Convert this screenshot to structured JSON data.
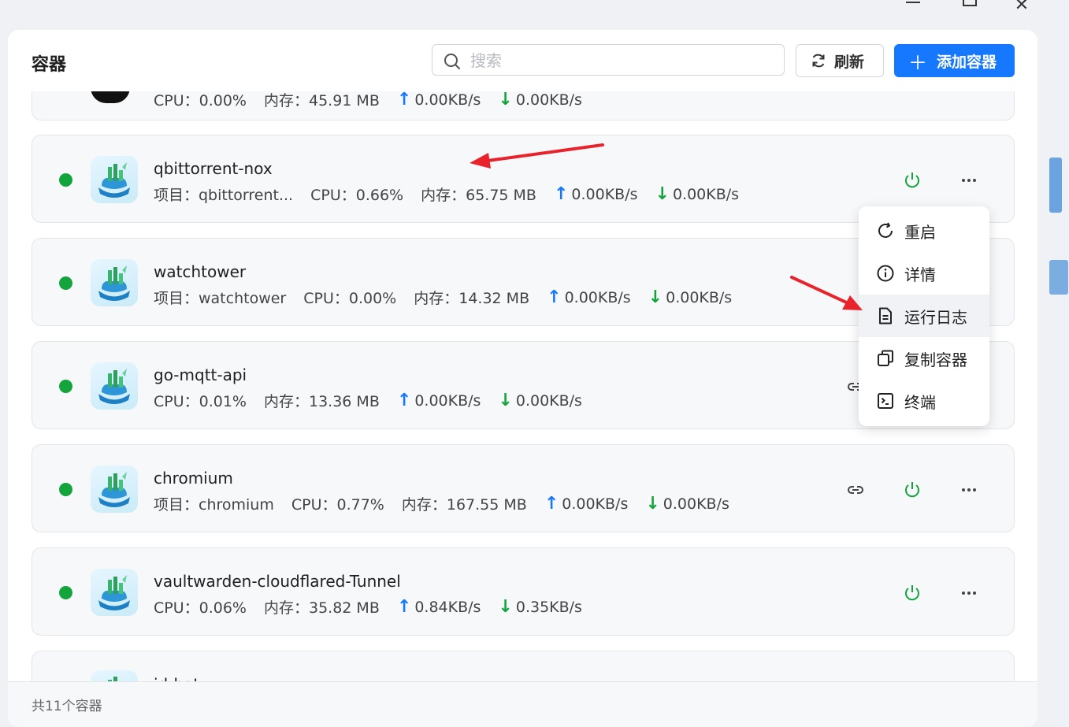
{
  "header": {
    "title": "容器",
    "search_placeholder": "搜索",
    "refresh_label": "刷新",
    "add_label": "添加容器"
  },
  "partial_top_card": {
    "cpu": "CPU：0.00%",
    "mem": "内存：45.91 MB",
    "up": "0.00KB/s",
    "down": "0.00KB/s"
  },
  "containers": [
    {
      "name": "qbittorrent-nox",
      "project": "项目：qbittorrent...",
      "cpu": "CPU：0.66%",
      "mem": "内存：65.75 MB",
      "up": "0.00KB/s",
      "down": "0.00KB/s",
      "status_color": "#13a43c"
    },
    {
      "name": "watchtower",
      "project": "项目：watchtower",
      "cpu": "CPU：0.00%",
      "mem": "内存：14.32 MB",
      "up": "0.00KB/s",
      "down": "0.00KB/s",
      "status_color": "#13a43c"
    },
    {
      "name": "go-mqtt-api",
      "project": "",
      "cpu": "CPU：0.01%",
      "mem": "内存：13.36 MB",
      "up": "0.00KB/s",
      "down": "0.00KB/s",
      "status_color": "#13a43c"
    },
    {
      "name": "chromium",
      "project": "项目：chromium",
      "cpu": "CPU：0.77%",
      "mem": "内存：167.55 MB",
      "up": "0.00KB/s",
      "down": "0.00KB/s",
      "status_color": "#13a43c"
    },
    {
      "name": "vaultwarden-cloudflared-Tunnel",
      "project": "",
      "cpu": "CPU：0.06%",
      "mem": "内存：35.82 MB",
      "up": "0.84KB/s",
      "down": "0.35KB/s",
      "status_color": "#13a43c"
    }
  ],
  "partial_bottom_card": {
    "name": "jd-bot"
  },
  "context_menu": {
    "items": [
      {
        "label": "重启",
        "icon": "restart-icon"
      },
      {
        "label": "详情",
        "icon": "info-icon"
      },
      {
        "label": "运行日志",
        "icon": "log-file-icon"
      },
      {
        "label": "复制容器",
        "icon": "copy-icon"
      },
      {
        "label": "终端",
        "icon": "terminal-icon"
      }
    ],
    "active_index": 2
  },
  "footer": {
    "count_text": "共11个容器"
  },
  "colors": {
    "accent": "#1677ff",
    "running": "#13a43c",
    "annotation_arrow": "#e8232b"
  }
}
